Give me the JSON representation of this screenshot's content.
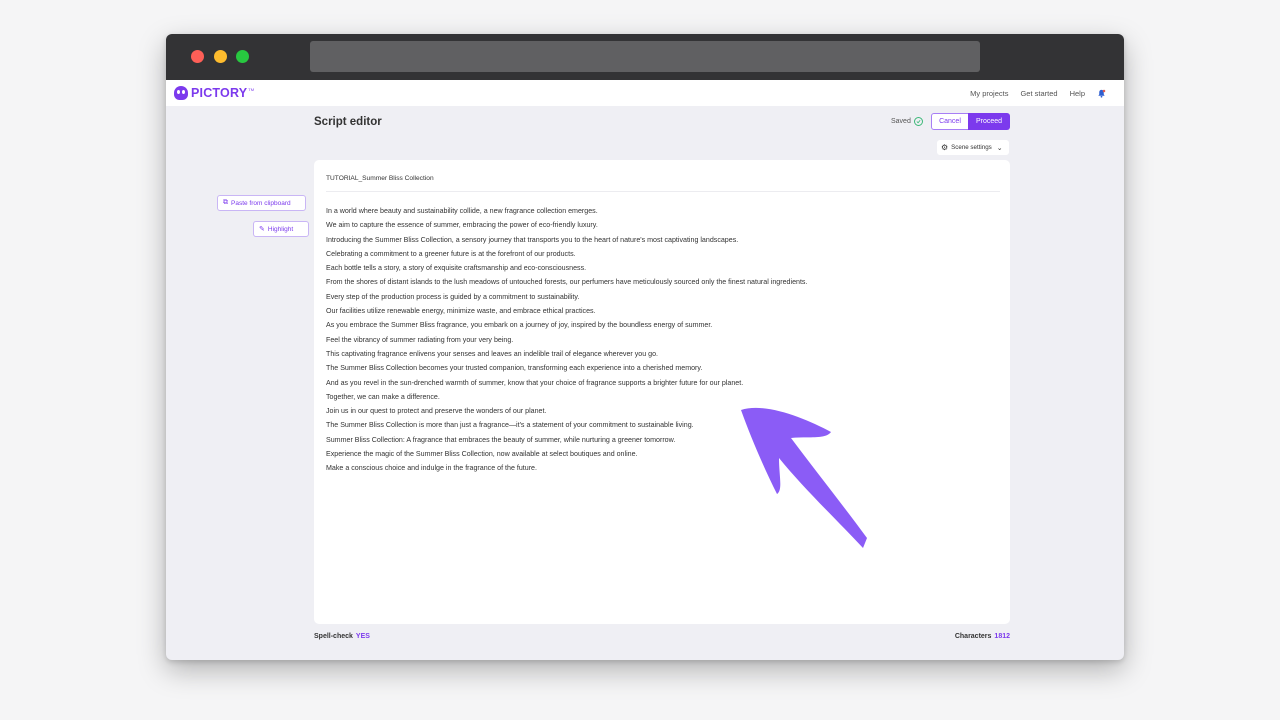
{
  "app": {
    "logo_text": "PICTORY",
    "logo_tm": "TM",
    "nav": [
      "My projects",
      "Get started",
      "Help"
    ]
  },
  "header": {
    "title": "Script editor",
    "saved_label": "Saved",
    "cancel_label": "Cancel",
    "proceed_label": "Proceed",
    "scene_settings_label": "Scene settings"
  },
  "sidebar": {
    "paste_label": "Paste from clipboard",
    "highlight_label": "Highlight"
  },
  "editor": {
    "doc_title": "TUTORIAL_Summer Bliss Collection",
    "lines": [
      "In a world where beauty and sustainability collide, a new fragrance collection emerges.",
      "We aim to capture the essence of summer, embracing the power of eco-friendly luxury.",
      "Introducing the Summer Bliss Collection, a sensory journey that transports you to the heart of nature's most captivating landscapes.",
      "Celebrating a commitment to a greener future is at the forefront of our products.",
      "Each bottle tells a story, a story of exquisite craftsmanship and eco-consciousness.",
      "From the shores of distant islands to the lush meadows of untouched forests, our perfumers have meticulously sourced only the finest natural ingredients.",
      "Every step of the production process is guided by a commitment to sustainability.",
      "Our facilities utilize renewable energy, minimize waste, and embrace ethical practices.",
      "As you embrace the Summer Bliss fragrance, you embark on a journey of joy, inspired by the boundless energy of summer.",
      "Feel the vibrancy of summer radiating from your very being.",
      "This captivating fragrance enlivens your senses and leaves an indelible trail of elegance wherever you go.",
      "The Summer Bliss Collection becomes your trusted companion, transforming each experience into a cherished memory.",
      "And as you revel in the sun-drenched warmth of summer, know that your choice of fragrance supports a brighter future for our planet.",
      "Together, we can make a difference.",
      "Join us in our quest to protect and preserve the wonders of our planet.",
      "The Summer Bliss Collection is more than just a fragrance—it's a statement of your commitment to sustainable living.",
      "Summer Bliss Collection: A fragrance that embraces the beauty of summer, while nurturing a greener tomorrow.",
      "Experience the magic of the Summer Bliss Collection, now available at select boutiques and online.",
      "Make a conscious choice and indulge in the fragrance of the future."
    ]
  },
  "footer": {
    "spellcheck_label": "Spell-check",
    "spellcheck_value": "YES",
    "characters_label": "Characters",
    "characters_value": "1812"
  },
  "colors": {
    "accent": "#7c3aed",
    "arrow": "#8b5cf6"
  },
  "icons": [
    "logo-icon",
    "bell-icon",
    "check-circle-icon",
    "gear-icon",
    "chevron-down-icon",
    "clipboard-icon",
    "highlighter-icon",
    "arrow-annotation-icon"
  ]
}
